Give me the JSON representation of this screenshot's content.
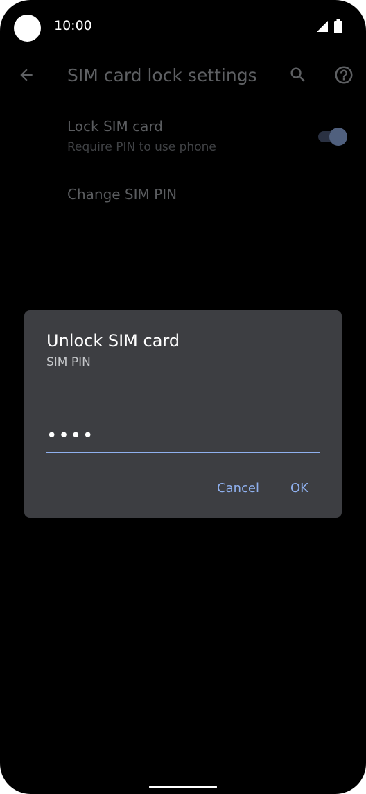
{
  "status_bar": {
    "time": "10:00"
  },
  "app_bar": {
    "title": "SIM card lock settings",
    "back_icon": "arrow-back-icon",
    "search_icon": "search-icon",
    "help_icon": "help-circle-icon"
  },
  "settings": {
    "lock_sim": {
      "title": "Lock SIM card",
      "subtitle": "Require PIN to use phone",
      "enabled": true
    },
    "change_pin": {
      "title": "Change SIM PIN"
    }
  },
  "dialog": {
    "title": "Unlock SIM card",
    "subtitle": "SIM PIN",
    "pin_value": "••••",
    "cancel_label": "Cancel",
    "ok_label": "OK"
  },
  "colors": {
    "background": "#000000",
    "dialog_bg": "#3d3e42",
    "accent": "#8fb0ee"
  }
}
